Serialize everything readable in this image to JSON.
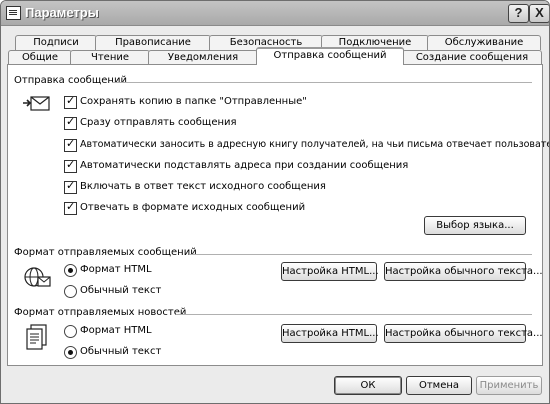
{
  "window": {
    "title": "Параметры",
    "help_label": "?",
    "close_label": "X"
  },
  "tabs_row1": [
    "Подписи",
    "Правописание",
    "Безопасность",
    "Подключение",
    "Обслуживание"
  ],
  "tabs_row2": [
    "Общие",
    "Чтение",
    "Уведомления",
    "Отправка сообщений",
    "Создание сообщения"
  ],
  "active_tab": "Отправка сообщений",
  "sending": {
    "title": "Отправка сообщений",
    "options": [
      {
        "label": "Сохранять копию в папке \"Отправленные\"",
        "checked": true
      },
      {
        "label": "Сразу отправлять сообщения",
        "checked": true
      },
      {
        "label": "Автоматически заносить в адресную книгу получателей, на чьи письма отвечает пользователь",
        "checked": true
      },
      {
        "label": "Автоматически подставлять адреса при создании сообщения",
        "checked": true
      },
      {
        "label": "Включать в ответ текст исходного сообщения",
        "checked": true
      },
      {
        "label": "Отвечать в формате исходных сообщений",
        "checked": true
      }
    ],
    "language_button": "Выбор языка..."
  },
  "mail_format": {
    "title": "Формат отправляемых сообщений",
    "html_label": "Формат HTML",
    "plain_label": "Обычный текст",
    "selected": "Формат HTML",
    "html_settings": "Настройка HTML...",
    "plain_settings": "Настройка обычного текста..."
  },
  "news_format": {
    "title": "Формат отправляемых новостей",
    "html_label": "Формат HTML",
    "plain_label": "Обычный текст",
    "selected": "Обычный текст",
    "html_settings": "Настройка HTML...",
    "plain_settings": "Настройка обычного текста..."
  },
  "footer": {
    "ok": "ОК",
    "cancel": "Отмена",
    "apply": "Применить"
  },
  "icons": {
    "send": "outbox-icon",
    "mail_format": "globe-mail-icon",
    "news_format": "newspaper-icon"
  }
}
